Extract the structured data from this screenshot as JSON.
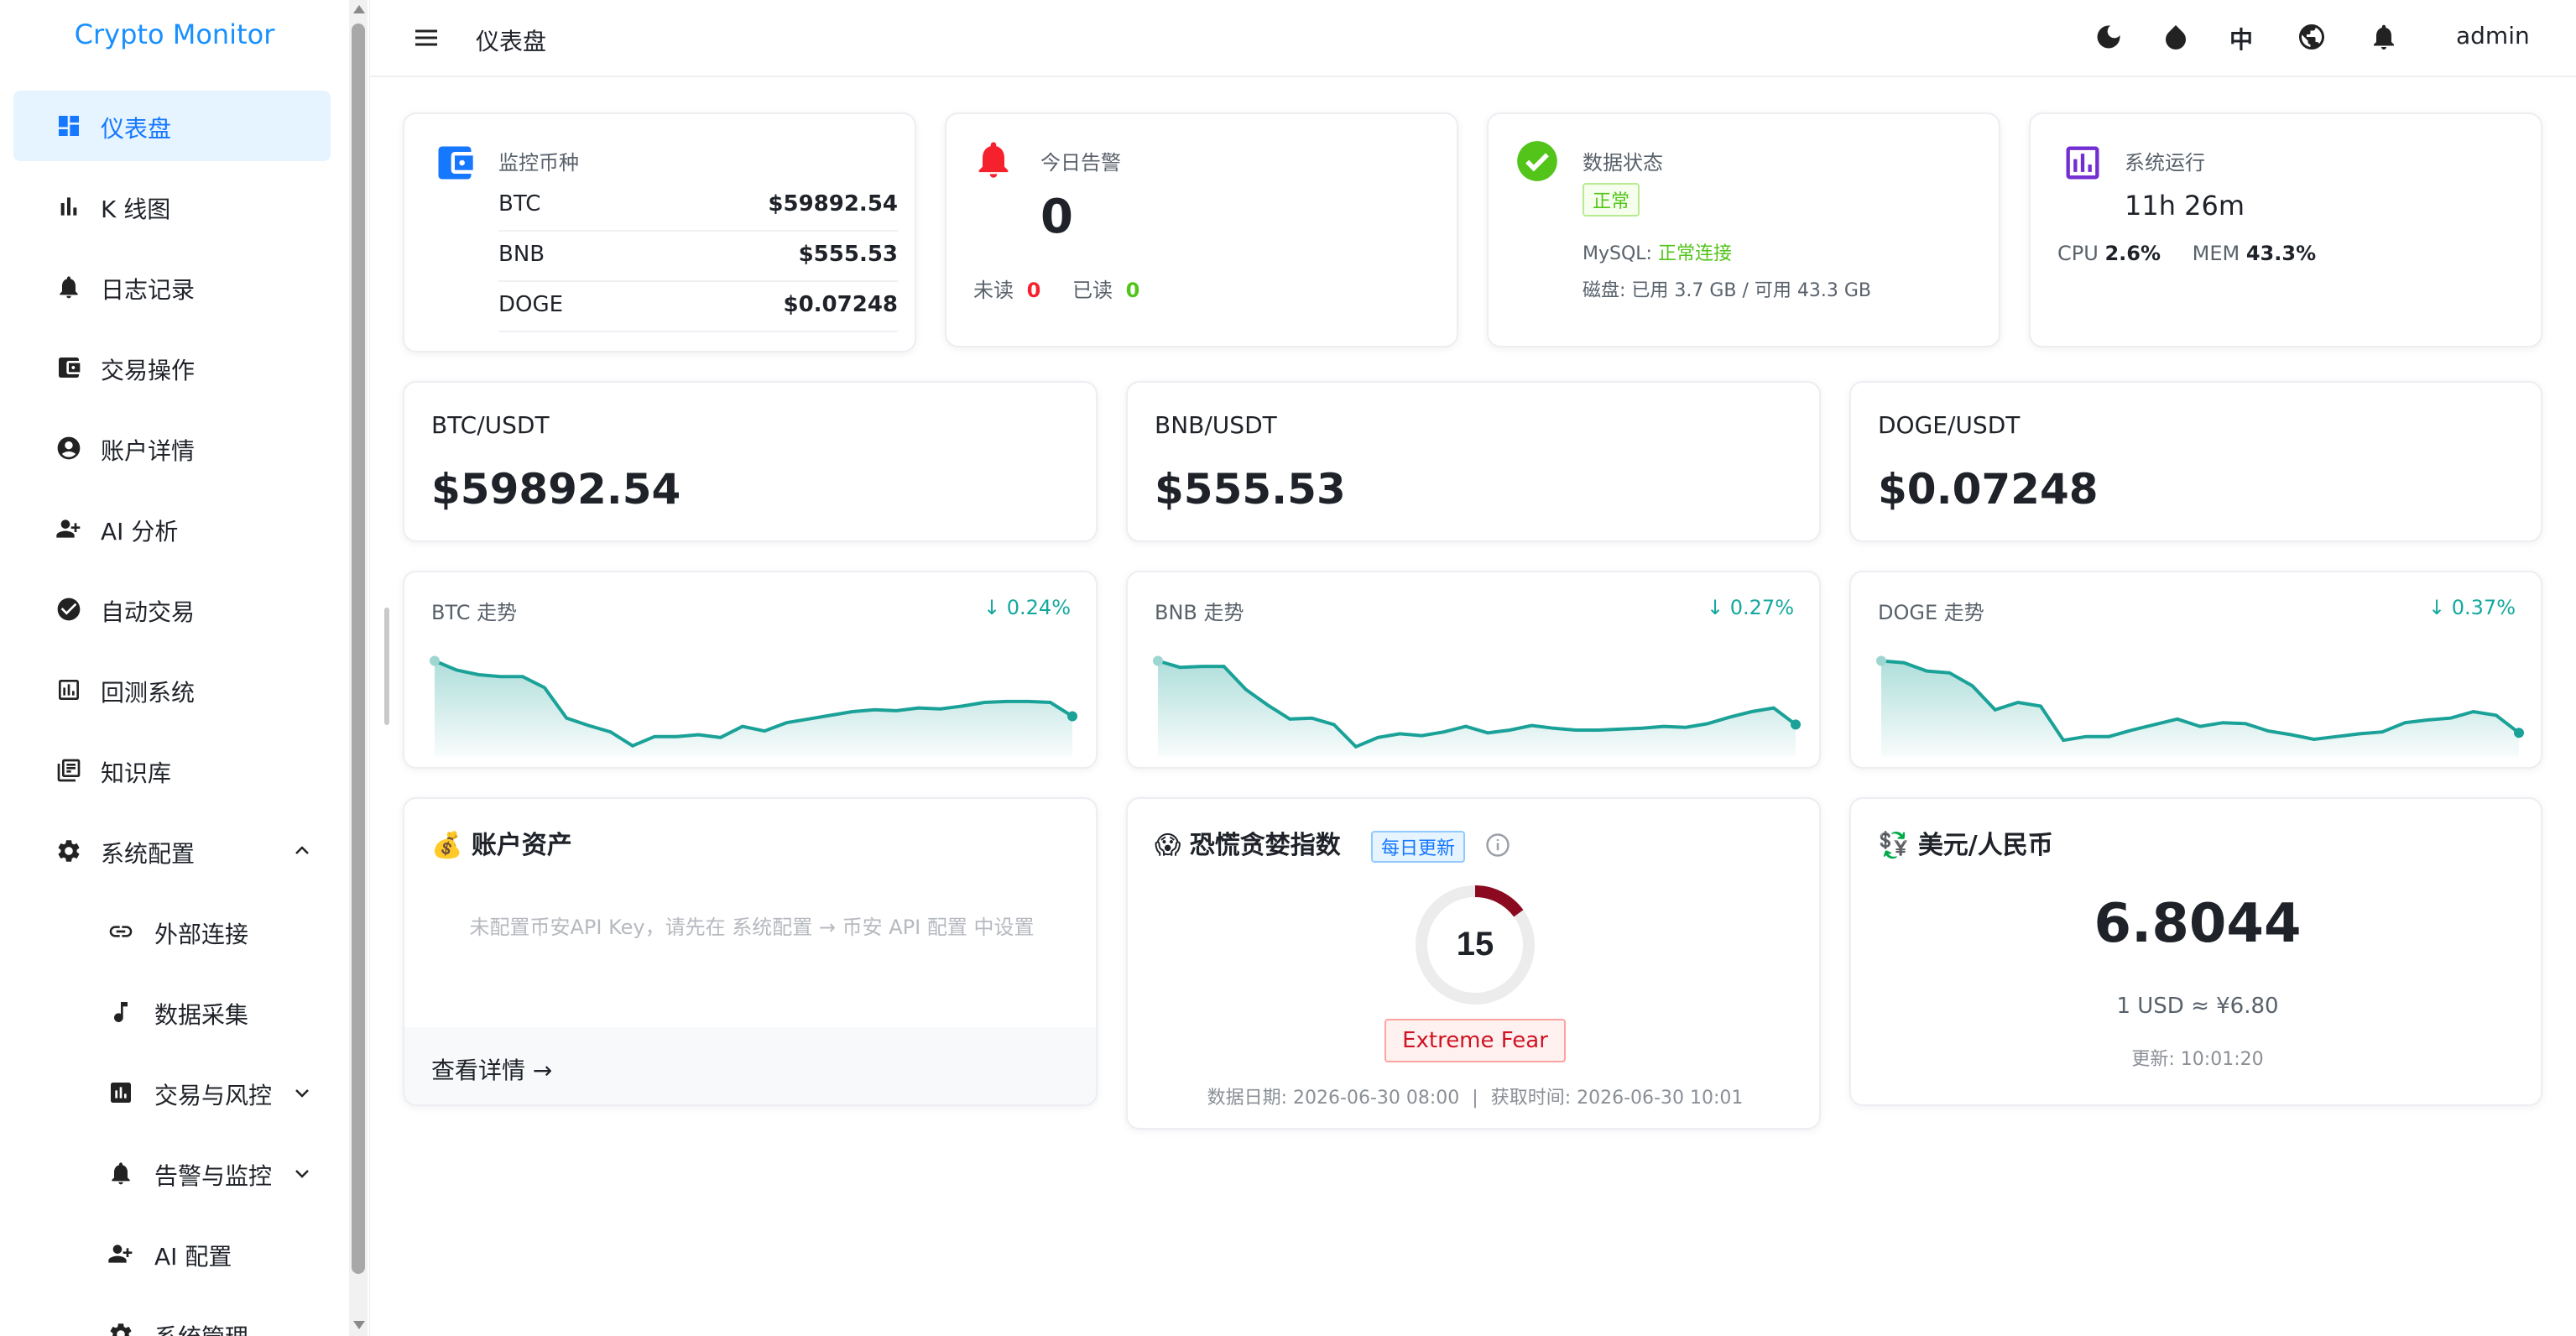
{
  "app": {
    "title": "Crypto Monitor"
  },
  "header": {
    "page_title": "仪表盘",
    "lang": "中",
    "user": "admin"
  },
  "sidebar": {
    "items": [
      {
        "label": "仪表盘",
        "icon": "dashboard-icon",
        "active": true
      },
      {
        "label": "K 线图",
        "icon": "bar-chart-icon"
      },
      {
        "label": "日志记录",
        "icon": "bell-icon"
      },
      {
        "label": "交易操作",
        "icon": "wallet-icon"
      },
      {
        "label": "账户详情",
        "icon": "account-icon"
      },
      {
        "label": "AI 分析",
        "icon": "user-plus-icon"
      },
      {
        "label": "自动交易",
        "icon": "check-circle-icon"
      },
      {
        "label": "回测系统",
        "icon": "chart-box-icon"
      },
      {
        "label": "知识库",
        "icon": "book-icon"
      },
      {
        "label": "系统配置",
        "icon": "gear-icon",
        "expanded": true
      },
      {
        "label": "外部连接",
        "icon": "link-icon",
        "sub": true
      },
      {
        "label": "数据采集",
        "icon": "music-note-icon",
        "sub": true
      },
      {
        "label": "交易与风控",
        "icon": "chart-box-icon",
        "sub": true
      },
      {
        "label": "告警与监控",
        "icon": "bell-icon",
        "sub": true
      },
      {
        "label": "AI 配置",
        "icon": "user-plus-icon",
        "sub": true
      },
      {
        "label": "系统管理",
        "icon": "gear-icon",
        "sub": true
      }
    ]
  },
  "stats": {
    "coins": {
      "title": "监控币种",
      "rows": [
        {
          "name": "BTC",
          "value": "$59892.54"
        },
        {
          "name": "BNB",
          "value": "$555.53"
        },
        {
          "name": "DOGE",
          "value": "$0.07248"
        }
      ]
    },
    "alerts": {
      "title": "今日告警",
      "count": "0",
      "unread_label": "未读",
      "unread": "0",
      "read_label": "已读",
      "read": "0"
    },
    "data_status": {
      "title": "数据状态",
      "tag": "正常",
      "mysql_label": "MySQL:",
      "mysql_value": "正常连接",
      "disk": "磁盘: 已用 3.7 GB / 可用 43.3 GB"
    },
    "system": {
      "title": "系统运行",
      "uptime": "11h 26m",
      "cpu_label": "CPU",
      "cpu": "2.6%",
      "mem_label": "MEM",
      "mem": "43.3%"
    }
  },
  "pairs": [
    {
      "name": "BTC/USDT",
      "price": "$59892.54"
    },
    {
      "name": "BNB/USDT",
      "price": "$555.53"
    },
    {
      "name": "DOGE/USDT",
      "price": "$0.07248"
    }
  ],
  "trends": [
    {
      "title": "BTC 走势",
      "change": "↓ 0.24%"
    },
    {
      "title": "BNB 走势",
      "change": "↓ 0.27%"
    },
    {
      "title": "DOGE 走势",
      "change": "↓ 0.37%"
    }
  ],
  "chart_data": [
    {
      "type": "area",
      "title": "BTC 走势",
      "y": [
        0.95,
        0.85,
        0.8,
        0.78,
        0.78,
        0.66,
        0.33,
        0.25,
        0.18,
        0.03,
        0.13,
        0.13,
        0.15,
        0.12,
        0.24,
        0.19,
        0.28,
        0.32,
        0.36,
        0.4,
        0.42,
        0.41,
        0.44,
        0.43,
        0.46,
        0.5,
        0.51,
        0.51,
        0.5,
        0.35
      ]
    },
    {
      "type": "area",
      "title": "BNB 走势",
      "y": [
        0.95,
        0.88,
        0.89,
        0.89,
        0.64,
        0.47,
        0.32,
        0.33,
        0.26,
        0.02,
        0.12,
        0.16,
        0.14,
        0.18,
        0.24,
        0.17,
        0.2,
        0.25,
        0.22,
        0.2,
        0.2,
        0.21,
        0.22,
        0.24,
        0.23,
        0.27,
        0.34,
        0.4,
        0.44,
        0.26
      ]
    },
    {
      "type": "area",
      "title": "DOGE 走势",
      "y": [
        0.95,
        0.93,
        0.84,
        0.82,
        0.68,
        0.42,
        0.5,
        0.46,
        0.09,
        0.13,
        0.13,
        0.2,
        0.26,
        0.32,
        0.24,
        0.28,
        0.27,
        0.19,
        0.15,
        0.1,
        0.13,
        0.16,
        0.18,
        0.28,
        0.31,
        0.33,
        0.4,
        0.36,
        0.17
      ]
    }
  ],
  "assets": {
    "title": "账户资产",
    "empty": "未配置币安API Key，请先在 系统配置 → 币安 API 配置 中设置",
    "link": "查看详情 →"
  },
  "fear_greed": {
    "title": "恐慌贪婪指数",
    "badge": "每日更新",
    "value": 15,
    "label": "Extreme Fear",
    "data_date": "数据日期: 2026-06-30 08:00",
    "sep": "|",
    "fetch_time": "获取时间: 2026-06-30 10:01"
  },
  "fx": {
    "title": "美元/人民币",
    "rate": "6.8044",
    "sub": "1 USD ≈ ¥6.80",
    "updated": "更新: 10:01:20"
  },
  "colors": {
    "accent": "#1677ff",
    "trend": "#1aa198",
    "danger": "#f5222d",
    "success": "#52c41a",
    "fear": "#8b0a1f"
  }
}
